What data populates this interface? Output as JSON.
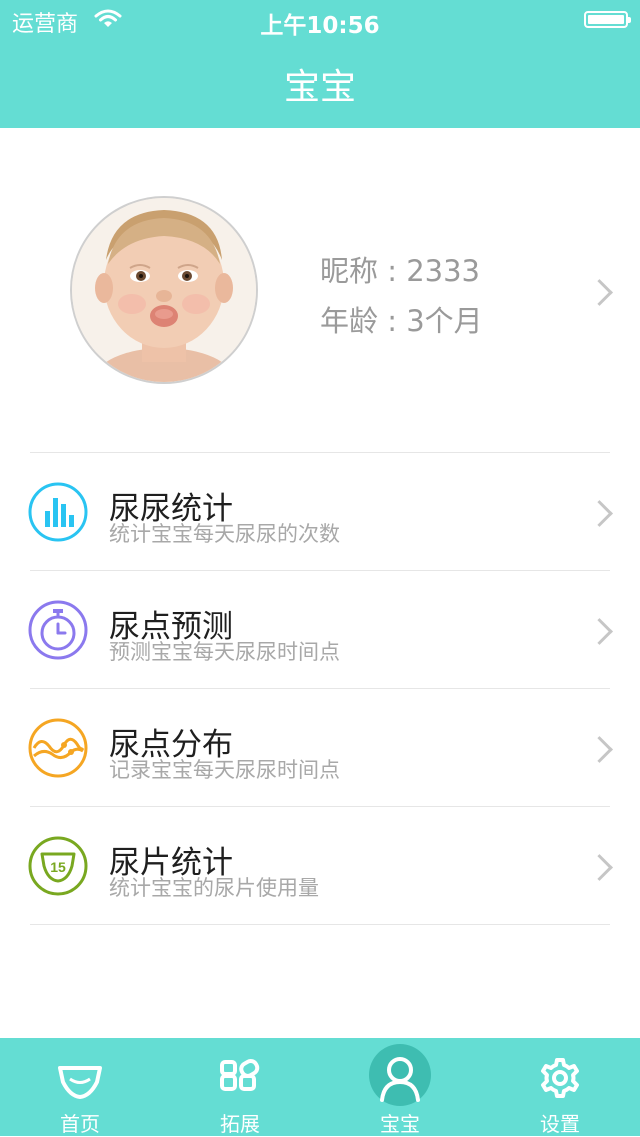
{
  "status": {
    "carrier": "运营商",
    "time": "上午10:56"
  },
  "header": {
    "title": "宝宝"
  },
  "profile": {
    "nickname": "昵称 : 2333",
    "age": "年龄 : 3个月"
  },
  "menu": [
    {
      "title": "尿尿统计",
      "subtitle": "统计宝宝每天尿尿的次数",
      "icon": "bar-chart-icon",
      "color": "#29c4f2"
    },
    {
      "title": "尿点预测",
      "subtitle": "预测宝宝每天尿尿时间点",
      "icon": "stopwatch-icon",
      "color": "#8b79ee"
    },
    {
      "title": "尿点分布",
      "subtitle": "记录宝宝每天尿尿时间点",
      "icon": "wave-distribution-icon",
      "color": "#f5a623"
    },
    {
      "title": "尿片统计",
      "subtitle": "统计宝宝的尿片使用量",
      "icon": "diaper-15-icon",
      "color": "#79a820",
      "badge": "15"
    }
  ],
  "tabs": [
    {
      "label": "首页",
      "icon": "diaper-icon"
    },
    {
      "label": "拓展",
      "icon": "apps-grid-icon"
    },
    {
      "label": "宝宝",
      "icon": "person-icon",
      "active": true
    },
    {
      "label": "设置",
      "icon": "gear-icon"
    }
  ],
  "colors": {
    "accent": "#64ddd3",
    "active_tab": "#3ebdb1"
  }
}
